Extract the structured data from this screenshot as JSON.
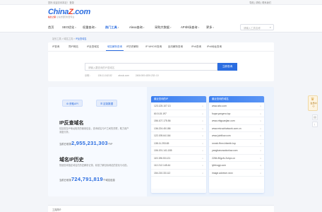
{
  "topbar": {
    "left": "您好,欢迎访问本站！  登录",
    "right": "导航 | 帮助 | 联系我们"
  },
  "logo": {
    "brand_a": "China",
    "brand_z": "Z",
    "brand_b": ".com",
    "sub_cn": "站长之家",
    "sub_tail": "让站长更轻松更专业"
  },
  "nav": {
    "items": [
      {
        "label": "首页",
        "active": false
      },
      {
        "label": "SEO优化",
        "active": false
      },
      {
        "label": "权重查询",
        "active": false
      },
      {
        "label": "热门工具",
        "active": true
      },
      {
        "label": "Alexa查询",
        "active": false
      },
      {
        "label": "采购大数据",
        "active": false
      },
      {
        "label": "API市场查询",
        "active": false
      },
      {
        "label": "更多",
        "active": false
      }
    ],
    "search_placeholder": "请输入工具名称"
  },
  "breadcrumb": {
    "home": "站长工具",
    "sep": ">",
    "mid": "域名工具",
    "current": "IP反查域名"
  },
  "query": {
    "tabs": [
      "IP查询",
      "同IP网站",
      "IP反查域名",
      "域名解析查询",
      "IP历史解析",
      "IP WHOIS查询",
      "反向解析查询",
      "IPv6查询",
      "IPv6地址查询"
    ],
    "active_tab": 3,
    "placeholder": "请输入要查询的IP或域名",
    "button": "立即查询",
    "examples": [
      "示例：",
      "136.11.162.82",
      "ahzuk.com",
      "2406:000:4200:232::10"
    ]
  },
  "hero": {
    "api_btn": "获取API",
    "batch_btn": "定制数据",
    "sec1_title": "IP反查域名",
    "sec1_desc": "包括查至IP地址相关的使用信息，查询域名与IP之间的关联，助力用户深度分析。",
    "sec1_prefix": "当前已收录",
    "sec1_num": "2,955,231,303",
    "sec1_suffix": "个IP",
    "sec2_title": "域名IP历史",
    "sec2_desc": "快速查询指定域名的历史解析记录，精准了解目标网站的变化与动态。",
    "sec2_prefix": "当前已收录",
    "sec2_num": "724,791,819",
    "sec2_suffix": "个域名信息"
  },
  "ip_list": {
    "title": "最近查询的IP",
    "rows": [
      "123.125.107.13",
      "60.5.15.197",
      "156.107.175.56",
      "136.224.45.186",
      "122.195.64.164",
      "138.11.253.65",
      "106.191.141.185",
      "119.196.53.121",
      "112.212.145.44",
      "154.210.33.112"
    ]
  },
  "domain_list": {
    "title": "最近查询的域名",
    "rows": [
      "www.abc.com",
      "fuqar.yangeru.top",
      "www.zhiguanjian.com",
      "www.ertzuchiaiwork.com.cn",
      "www.joinflow.com",
      "nnnxb.ffmn.trbenth.top",
      "yanghanzaodunkav.com",
      "2284.80gzfc.2shpx.cn",
      "lybhvqgr.com",
      "image.advesm.xxxx"
    ]
  },
  "bottom": {
    "label": "工具简介"
  },
  "float": {
    "label": "会员中心"
  }
}
